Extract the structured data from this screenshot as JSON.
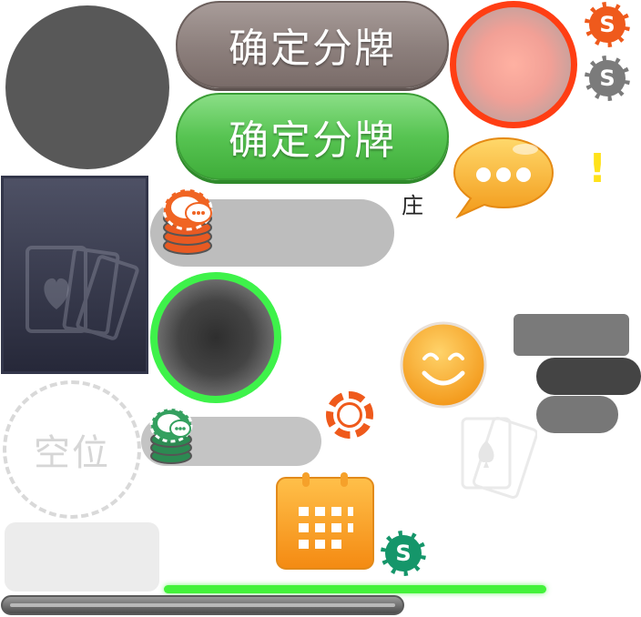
{
  "buttons": {
    "confirm_deal_disabled": "确定分牌",
    "confirm_deal": "确定分牌"
  },
  "coins": {
    "orange_symbol": "S",
    "gray_symbol": "S",
    "green_symbol": "S"
  },
  "labels": {
    "banker": "庄",
    "alert": "!",
    "empty_seat": "空位"
  },
  "icons": {
    "chat": "chat-bubble-icon",
    "smiley": "smiley-icon",
    "calendar": "calendar-icon",
    "cards": "cards-icon",
    "chip_stack": "chip-stack-icon"
  },
  "colors": {
    "accent_orange": "#ef5a1c",
    "accent_green": "#3ef24a",
    "accent_red": "#ff3e14",
    "button_green": "#57c452",
    "button_gray": "#8c7f7c",
    "alert_yellow": "#ffe21a"
  }
}
